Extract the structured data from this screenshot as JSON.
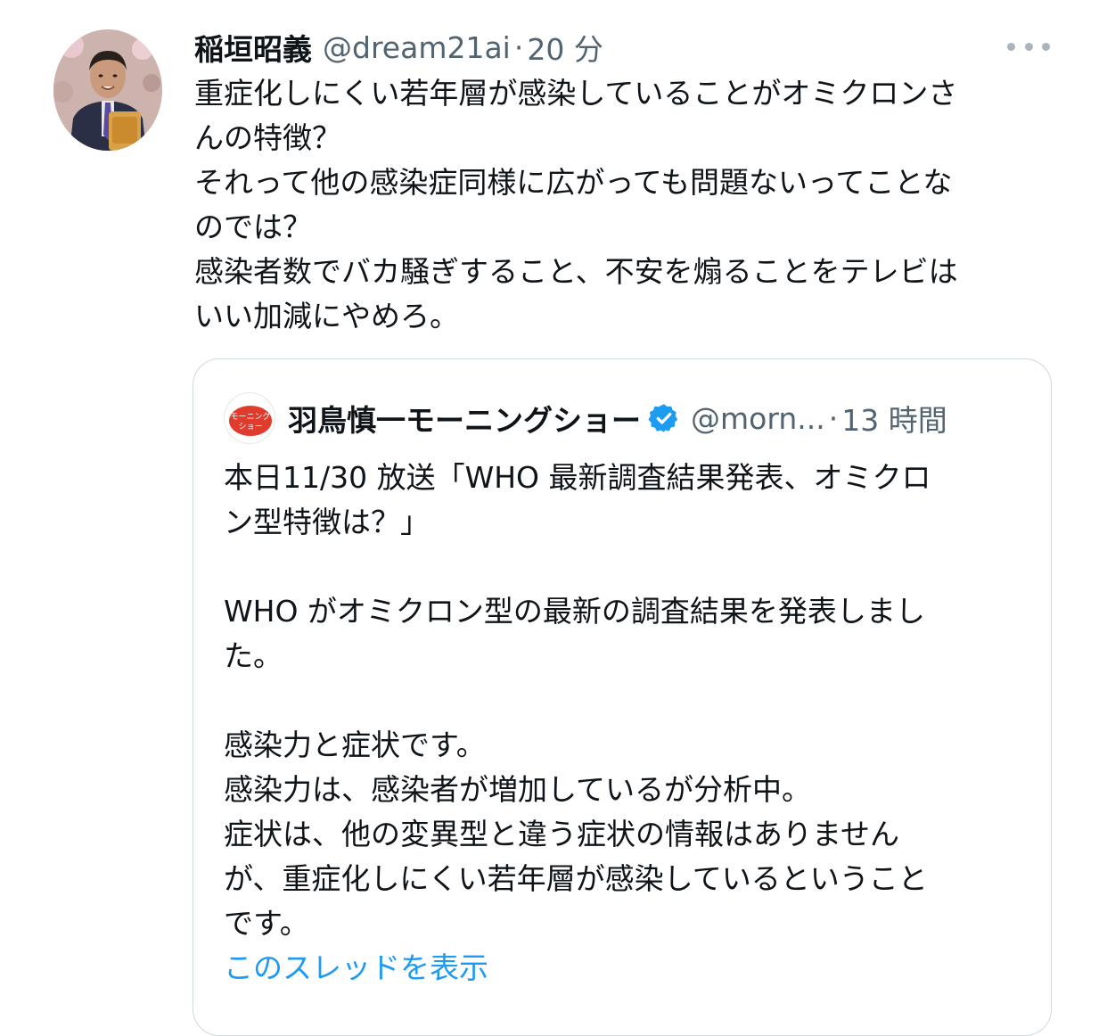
{
  "tweet": {
    "author_name": "稲垣昭義",
    "author_handle": "@dream21ai",
    "separator": "·",
    "time": "20 分",
    "lines": [
      "重症化しにくい若年層が感染していることがオミクロンさ",
      "んの特徴？",
      "それって他の感染症同様に広がっても問題ないってことな",
      "のでは？",
      "感染者数でバカ騒ぎすること、不安を煽ることをテレビは",
      "いい加減にやめろ。"
    ]
  },
  "quote": {
    "author_name": "羽鳥慎一モーニングショー",
    "author_handle": "@morn...",
    "separator": "·",
    "time": "13 時間",
    "avatar_text": {
      "line1": "モーニング",
      "line2": "ショー"
    },
    "lines_1": [
      "本日11/30 放送「WHO 最新調査結果発表、オミクロ",
      "ン型特徴は？」"
    ],
    "lines_2": [
      "WHO がオミクロン型の最新の調査結果を発表しまし",
      "た。"
    ],
    "lines_3": [
      "感染力と症状です。",
      "感染力は、感染者が増加しているが分析中。",
      "症状は、他の変異型と違う症状の情報はありません",
      "が、重症化しにくい若年層が感染しているということ",
      "です。"
    ],
    "show_thread": "このスレッドを表示"
  },
  "colors": {
    "link": "#1d9bf0",
    "secondary": "#536471",
    "border": "#cfd9de",
    "verified": "#1d9bf0"
  }
}
